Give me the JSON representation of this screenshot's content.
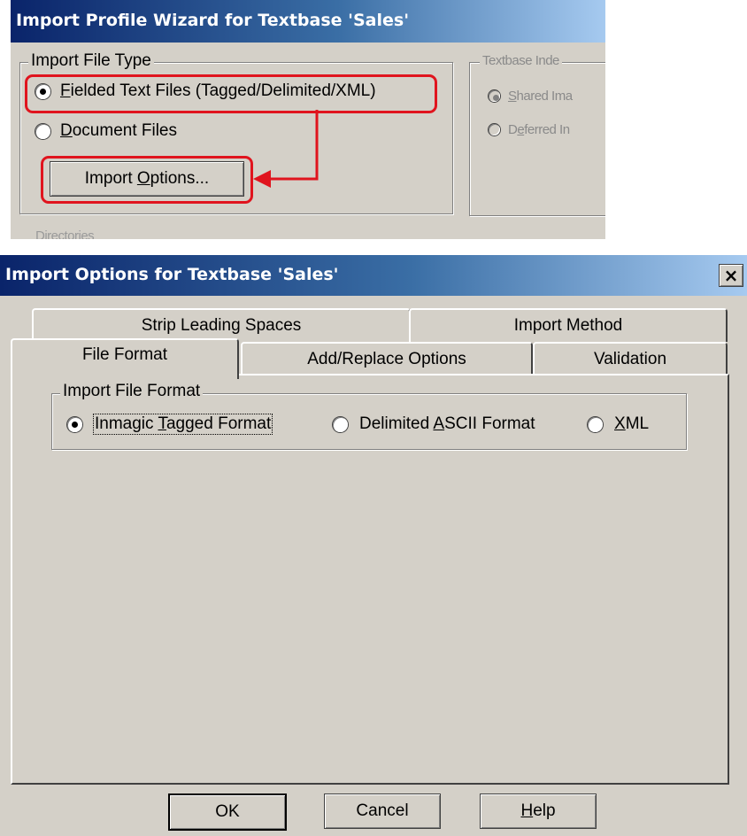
{
  "wizard": {
    "title": "Import Profile Wizard for Textbase 'Sales'",
    "file_type_group": "Import File Type",
    "options": [
      {
        "pre": "",
        "accel": "F",
        "post": "ielded Text Files (Tagged/Delimited/XML)",
        "selected": true
      },
      {
        "pre": "",
        "accel": "D",
        "post": "ocument Files",
        "selected": false
      }
    ],
    "import_options_button": {
      "pre": "Import ",
      "accel": "O",
      "post": "ptions..."
    },
    "index_group": "Textbase Inde",
    "index_options": [
      {
        "pre": "",
        "accel": "S",
        "post": "hared Ima",
        "selected": true
      },
      {
        "pre": "D",
        "accel": "e",
        "post": "ferred In",
        "selected": false
      }
    ],
    "cut_label": "Directories"
  },
  "dialog": {
    "title": "Import Options for Textbase 'Sales'",
    "close_glyph": "×",
    "tabs_back": [
      "Strip Leading Spaces",
      "Import Method"
    ],
    "tabs_front": [
      "File Format",
      "Add/Replace Options",
      "Validation"
    ],
    "active_tab": "File Format",
    "format_group": "Import File Format",
    "formats": [
      {
        "pre": "Inmagic ",
        "accel": "T",
        "post": "agged Format",
        "selected": true
      },
      {
        "pre": "Delimited ",
        "accel": "A",
        "post": "SCII Format",
        "selected": false
      },
      {
        "pre": "",
        "accel": "X",
        "post": "ML",
        "selected": false
      }
    ],
    "buttons": {
      "ok": "OK",
      "cancel": "Cancel",
      "help": {
        "pre": "",
        "accel": "H",
        "post": "elp"
      }
    }
  },
  "colors": {
    "highlight": "#e0141e",
    "titlebar": "#0a246a",
    "face": "#d4d0c8"
  }
}
